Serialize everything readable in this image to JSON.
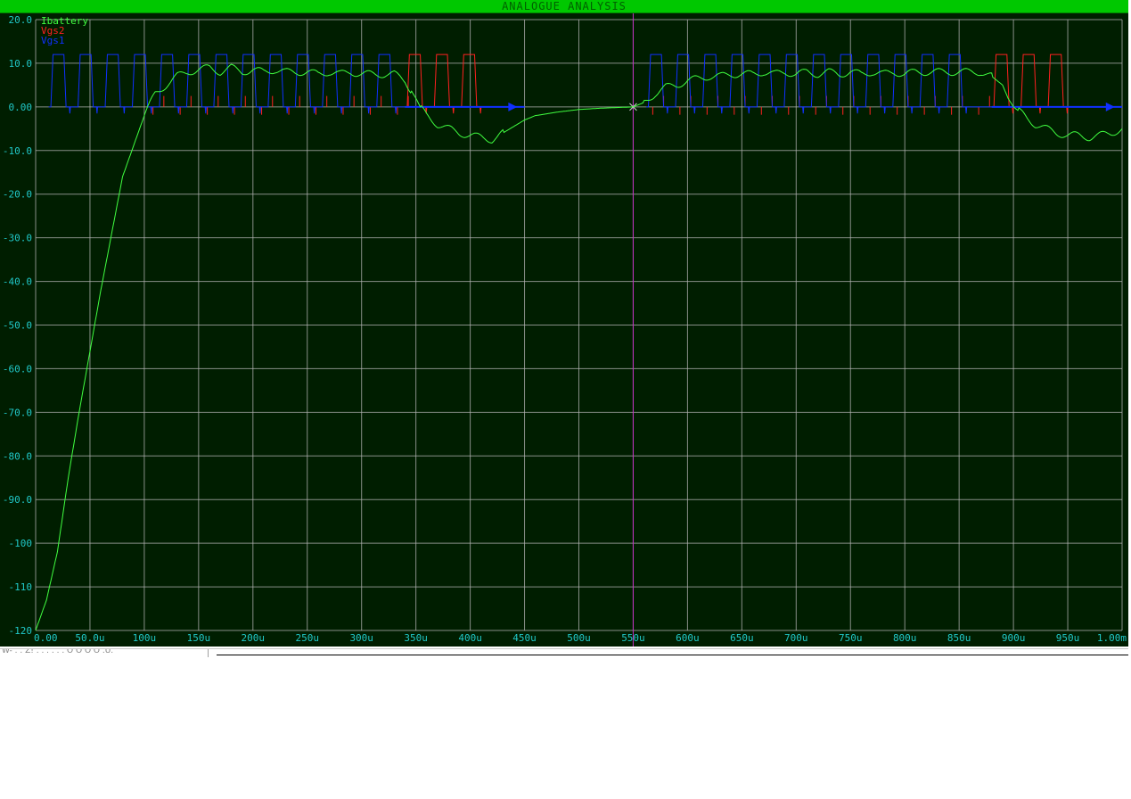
{
  "window": {
    "title": "ANALOGUE ANALYSIS",
    "status_left": "W- . . Z! . . . . . . O O O O  .U."
  },
  "colors": {
    "title_bar": "#00c800",
    "plot_background": "#001e00",
    "grid": "#b4b4b4",
    "tick_labels": "#20c8c8",
    "cursor": "#c030c0"
  },
  "chart_data": {
    "type": "line",
    "title": "ANALOGUE ANALYSIS",
    "xlabel": "",
    "ylabel": "",
    "xlim": [
      0,
      1000
    ],
    "ylim": [
      -120,
      20
    ],
    "grid": true,
    "legend_position": "top-left",
    "x_ticks": [
      0,
      50,
      100,
      150,
      200,
      250,
      300,
      350,
      400,
      450,
      500,
      550,
      600,
      650,
      700,
      750,
      800,
      850,
      900,
      950,
      1000
    ],
    "x_tick_labels": [
      "0.00",
      "50.0u",
      "100u",
      "150u",
      "200u",
      "250u",
      "300u",
      "350u",
      "400u",
      "450u",
      "500u",
      "550u",
      "600u",
      "650u",
      "700u",
      "750u",
      "800u",
      "850u",
      "900u",
      "950u",
      "1.00m"
    ],
    "y_ticks": [
      20,
      10,
      0,
      -10,
      -20,
      -30,
      -40,
      -50,
      -60,
      -70,
      -80,
      -90,
      -100,
      -110,
      -120
    ],
    "y_tick_labels": [
      "20.0",
      "10.0",
      "0.00",
      "-10.0",
      "-20.0",
      "-30.0",
      "-40.0",
      "-50.0",
      "-60.0",
      "-70.0",
      "-80.0",
      "-90.0",
      "-100",
      "-110",
      "-120"
    ],
    "cursor_x": 550,
    "series": [
      {
        "name": "Ibattery",
        "color": "#40ff40",
        "kind": "curve",
        "points": [
          [
            0,
            -120
          ],
          [
            10,
            -113
          ],
          [
            20,
            -102
          ],
          [
            30,
            -85
          ],
          [
            40,
            -70
          ],
          [
            50,
            -56
          ],
          [
            60,
            -42
          ],
          [
            70,
            -29
          ],
          [
            80,
            -16
          ],
          [
            90,
            -9
          ],
          [
            100,
            -2
          ],
          [
            110,
            3
          ],
          [
            120,
            5
          ],
          [
            130,
            7
          ],
          [
            140,
            8
          ],
          [
            150,
            8.5
          ],
          [
            160,
            9
          ],
          [
            170,
            8
          ],
          [
            180,
            9
          ],
          [
            190,
            8
          ],
          [
            200,
            8.5
          ],
          [
            210,
            8
          ],
          [
            220,
            8.5
          ],
          [
            230,
            8
          ],
          [
            240,
            8
          ],
          [
            250,
            8
          ],
          [
            260,
            7.5
          ],
          [
            270,
            8
          ],
          [
            280,
            7.5
          ],
          [
            290,
            8
          ],
          [
            300,
            7.5
          ],
          [
            310,
            7.5
          ],
          [
            320,
            7.5
          ],
          [
            330,
            7.5
          ],
          [
            340,
            6
          ],
          [
            345,
            4
          ],
          [
            350,
            2
          ],
          [
            355,
            -0.5
          ],
          [
            360,
            -2
          ],
          [
            370,
            -4
          ],
          [
            380,
            -5
          ],
          [
            390,
            -6
          ],
          [
            400,
            -6.5
          ],
          [
            410,
            -7
          ],
          [
            420,
            -7.5
          ],
          [
            430,
            -6
          ],
          [
            440,
            -4.5
          ],
          [
            450,
            -3
          ],
          [
            460,
            -2
          ],
          [
            480,
            -1.2
          ],
          [
            500,
            -0.6
          ],
          [
            520,
            -0.3
          ],
          [
            540,
            -0.1
          ],
          [
            550,
            0
          ],
          [
            560,
            1
          ],
          [
            570,
            3
          ],
          [
            580,
            4.5
          ],
          [
            590,
            5
          ],
          [
            600,
            6
          ],
          [
            610,
            6.5
          ],
          [
            620,
            7
          ],
          [
            630,
            7
          ],
          [
            640,
            7.5
          ],
          [
            650,
            7.5
          ],
          [
            660,
            7.5
          ],
          [
            670,
            8
          ],
          [
            680,
            7.5
          ],
          [
            690,
            8
          ],
          [
            700,
            7.5
          ],
          [
            710,
            8
          ],
          [
            720,
            7.5
          ],
          [
            730,
            8
          ],
          [
            740,
            7.5
          ],
          [
            750,
            8
          ],
          [
            760,
            7.5
          ],
          [
            770,
            8
          ],
          [
            780,
            7.5
          ],
          [
            790,
            8
          ],
          [
            800,
            7.5
          ],
          [
            810,
            8
          ],
          [
            820,
            8
          ],
          [
            830,
            8
          ],
          [
            840,
            8
          ],
          [
            850,
            8
          ],
          [
            860,
            8
          ],
          [
            870,
            8
          ],
          [
            880,
            7
          ],
          [
            890,
            5
          ],
          [
            895,
            2
          ],
          [
            900,
            0
          ],
          [
            910,
            -2
          ],
          [
            920,
            -4
          ],
          [
            930,
            -5
          ],
          [
            940,
            -6
          ],
          [
            950,
            -6.5
          ],
          [
            960,
            -6.5
          ],
          [
            970,
            -7
          ],
          [
            980,
            -6.5
          ],
          [
            990,
            -6
          ],
          [
            1000,
            -5
          ]
        ],
        "ripple_ranges": [
          [
            100,
            345
          ],
          [
            560,
            880
          ],
          [
            355,
            430
          ],
          [
            905,
            1000
          ]
        ],
        "ripple_amplitude": 0.8,
        "ripple_period": 25
      },
      {
        "name": "Vgs2",
        "color": "#ff2020",
        "kind": "pulse",
        "high": 12,
        "period": 25,
        "width": 10,
        "rise": 2,
        "spike_low": -1.5,
        "ranges": [
          [
            0,
            100
          ],
          [
            100,
            340
          ],
          [
            340,
            435
          ],
          [
            550,
            880
          ],
          [
            880,
            970
          ]
        ],
        "visible_ranges": [
          [
            340,
            435
          ],
          [
            880,
            970
          ]
        ]
      },
      {
        "name": "Vgs1",
        "color": "#1030ff",
        "kind": "pulse",
        "high": 12,
        "period": 25,
        "width": 10,
        "rise": 2,
        "spike_low": -1.5,
        "ranges": [
          [
            12,
            340
          ],
          [
            562,
            880
          ]
        ],
        "markers": [
          440,
          990
        ]
      }
    ]
  }
}
